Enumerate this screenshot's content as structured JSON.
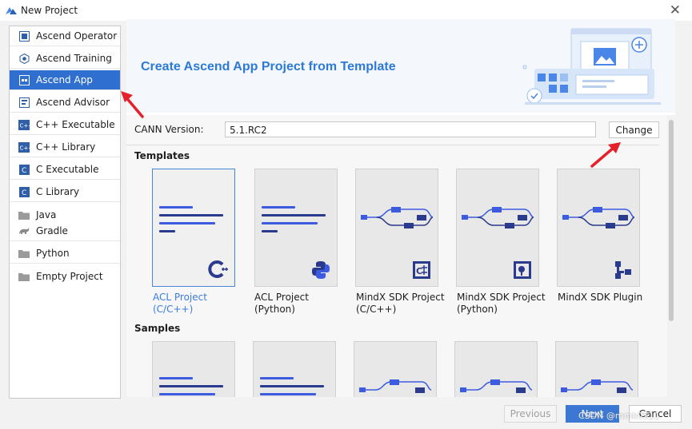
{
  "window": {
    "title": "New Project"
  },
  "sidebar": {
    "items": [
      {
        "label": "Ascend Operator",
        "icon": "ascend-operator-icon"
      },
      {
        "label": "Ascend Training",
        "icon": "ascend-training-icon"
      },
      {
        "label": "Ascend App",
        "icon": "ascend-app-icon",
        "selected": true
      },
      {
        "label": "Ascend Advisor",
        "icon": "ascend-advisor-icon"
      },
      {
        "label": "C++ Executable",
        "icon": "cpp-icon"
      },
      {
        "label": "C++ Library",
        "icon": "cpp-icon"
      },
      {
        "label": "C Executable",
        "icon": "c-icon"
      },
      {
        "label": "C Library",
        "icon": "c-icon"
      },
      {
        "label": "Java",
        "icon": "folder-icon"
      },
      {
        "label": "Gradle",
        "icon": "gradle-icon"
      },
      {
        "label": "Python",
        "icon": "folder-icon"
      },
      {
        "label": "Empty Project",
        "icon": "folder-icon"
      }
    ]
  },
  "banner": {
    "title": "Create Ascend App Project from Template"
  },
  "cann": {
    "label": "CANN Version:",
    "value": "5.1.RC2",
    "change_label": "Change"
  },
  "templates": {
    "heading": "Templates",
    "items": [
      {
        "line1": "ACL Project",
        "line2": "(C/C++)",
        "kind": "doc",
        "icon": "cpp-logo-icon",
        "selected": true
      },
      {
        "line1": "ACL Project",
        "line2": "(Python)",
        "kind": "doc",
        "icon": "python-logo-icon",
        "selected": false
      },
      {
        "line1": "MindX SDK Project",
        "line2": "(C/C++)",
        "kind": "flow",
        "icon": "mindx-cpp-icon",
        "selected": false
      },
      {
        "line1": "MindX SDK Project",
        "line2": "(Python)",
        "kind": "flow",
        "icon": "mindx-python-icon",
        "selected": false
      },
      {
        "line1": "MindX SDK Plugin",
        "line2": "",
        "kind": "flow",
        "icon": "mindx-plugin-icon",
        "selected": false
      }
    ]
  },
  "samples": {
    "heading": "Samples"
  },
  "footer": {
    "previous_label": "Previous",
    "next_label": "Next",
    "cancel_label": "Cancel"
  },
  "watermark": "CSDN @mmk0511",
  "colors": {
    "accent": "#2f6fd0",
    "banner_title": "#2d7ad6",
    "annotation": "#e5202a",
    "diagram_blue": "#3d5be0",
    "diagram_navy": "#2a3a8c"
  }
}
